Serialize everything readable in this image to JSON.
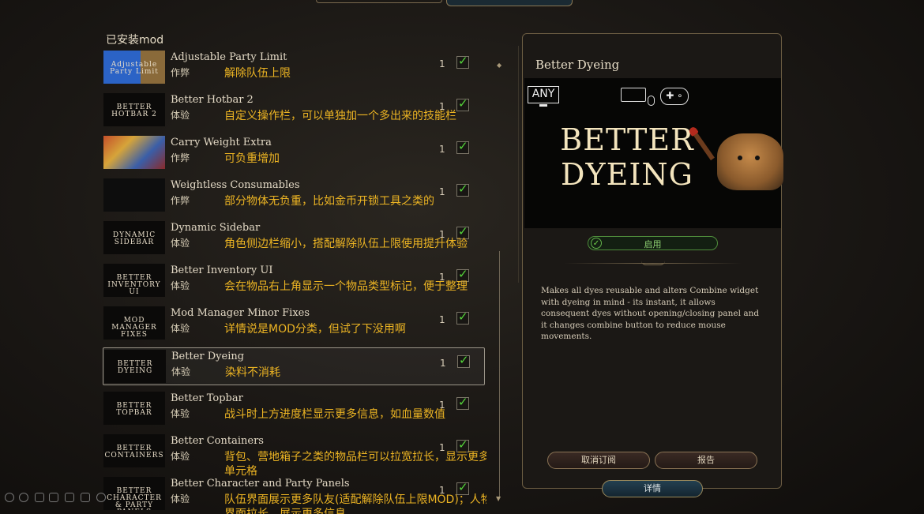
{
  "list": {
    "title": "已安装mod",
    "mods": [
      {
        "name": "Adjustable Party Limit",
        "category": "作弊",
        "note": "解除队伍上限",
        "count": "1",
        "thumb": "Adjustable Party Limit",
        "checked": true
      },
      {
        "name": "Better Hotbar 2",
        "category": "体验",
        "note": "自定义操作栏，可以单独加一个多出来的技能栏",
        "count": "1",
        "thumb": "BETTER HOTBAR 2",
        "checked": true
      },
      {
        "name": "Carry Weight Extra",
        "category": "作弊",
        "note": "可负重增加",
        "count": "1",
        "thumb": "",
        "checked": true
      },
      {
        "name": "Weightless Consumables",
        "category": "作弊",
        "note": "部分物体无负重，比如金币开锁工具之类的",
        "count": "1",
        "thumb": "",
        "checked": true
      },
      {
        "name": "Dynamic Sidebar",
        "category": "体验",
        "note": "角色侧边栏缩小，搭配解除队伍上限使用提升体验",
        "count": "1",
        "thumb": "DYNAMIC SIDEBAR",
        "checked": true
      },
      {
        "name": "Better Inventory UI",
        "category": "体验",
        "note": "会在物品右上角显示一个物品类型标记，便于整理",
        "count": "1",
        "thumb": "BETTER INVENTORY UI",
        "checked": true
      },
      {
        "name": "Mod Manager Minor Fixes",
        "category": "体验",
        "note": "详情说是MOD分类，但试了下没用啊",
        "count": "1",
        "thumb": "MOD MANAGER FIXES",
        "checked": true
      },
      {
        "name": "Better Dyeing",
        "category": "体验",
        "note": "染料不消耗",
        "count": "1",
        "thumb": "BETTER DYEING",
        "checked": true,
        "selected": true
      },
      {
        "name": "Better Topbar",
        "category": "体验",
        "note": "战斗时上方进度栏显示更多信息，如血量数值",
        "count": "1",
        "thumb": "BETTER TOPBAR",
        "checked": true
      },
      {
        "name": "Better Containers",
        "category": "体验",
        "note": "背包、营地箱子之类的物品栏可以拉宽拉长，显示更多单元格",
        "count": "1",
        "thumb": "BETTER CONTAINERS",
        "checked": true
      },
      {
        "name": "Better Character and Party Panels",
        "category": "体验",
        "note": "队伍界面展示更多队友(适配解除队伍上限MOD)；人物界面拉长，展示更多信息",
        "count": "1",
        "thumb": "BETTER CHARACTER & PARTY PANELS",
        "checked": true
      }
    ]
  },
  "details": {
    "title": "Better Dyeing",
    "badge": "ANY",
    "banner_title": "BETTER DYEING",
    "enable_label": "启用",
    "description": "Makes all dyes reusable and alters Combine widget with dyeing in mind - its instant, it allows consequent dyes without opening/closing panel and it changes combine button to reduce mouse movements.",
    "unsubscribe_label": "取消订阅",
    "report_label": "报告",
    "details_label": "详情"
  },
  "colors": {
    "note": "#ecb423",
    "check": "#55d63a",
    "panel_border": "#6b5c42",
    "accent_button": "#234050"
  }
}
